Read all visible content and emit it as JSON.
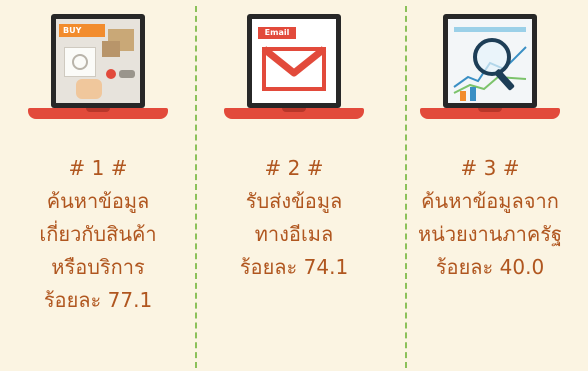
{
  "items": [
    {
      "number": "# 1 #",
      "lines": [
        "ค้นหาข้อมูล",
        "เกี่ยวกับสินค้า",
        "หรือบริการ"
      ],
      "percent": "ร้อยละ 77.1",
      "screen_label": "BUY"
    },
    {
      "number": "# 2 #",
      "lines": [
        "รับส่งข้อมูล",
        "ทางอีเมล"
      ],
      "percent": "ร้อยละ 74.1",
      "screen_label": "Email"
    },
    {
      "number": "# 3 #",
      "lines": [
        "ค้นหาข้อมูลจาก",
        "หน่วยงานภาครัฐ"
      ],
      "percent": "ร้อยละ 40.0"
    }
  ],
  "colors": {
    "background": "#fbf4e2",
    "text": "#b0561f",
    "divider": "#8cc15b",
    "laptop_base": "#e24a3b",
    "laptop_lid": "#272727"
  },
  "icons": [
    "shopping-screen-icon",
    "email-envelope-icon",
    "magnifier-chart-icon"
  ]
}
